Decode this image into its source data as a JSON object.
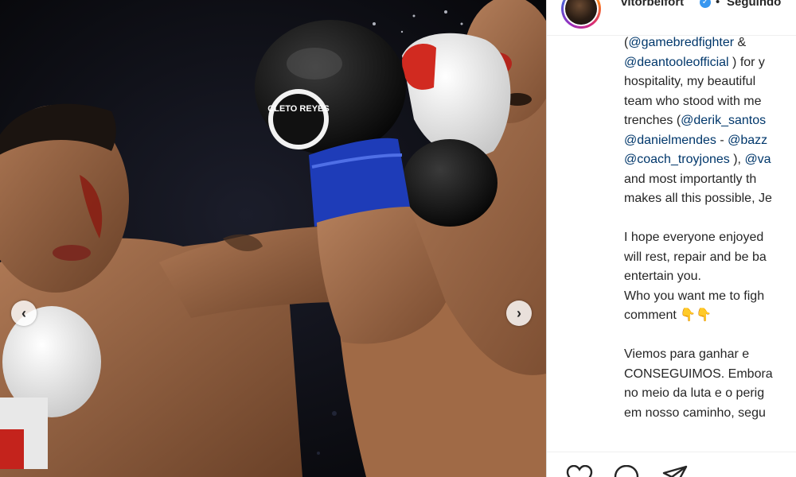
{
  "header": {
    "username": "vitorbelfort",
    "verified": "✓",
    "separator": "•",
    "follow_label": "Seguindo"
  },
  "photo": {
    "glove_brand": "CLETO REYES",
    "prev_icon": "chevron-left-icon",
    "next_icon": "chevron-right-icon",
    "prev_glyph": "‹",
    "next_glyph": "›"
  },
  "caption": {
    "lines": [
      [
        {
          "t": "(",
          "m": false
        },
        {
          "t": "@gamebredfighter",
          "m": true
        },
        {
          "t": " &",
          "m": false
        }
      ],
      [
        {
          "t": "@deantooleofficial",
          "m": true
        },
        {
          "t": " ) for y",
          "m": false
        }
      ],
      [
        {
          "t": "hospitality, my beautiful",
          "m": false
        }
      ],
      [
        {
          "t": "team who stood with me",
          "m": false
        }
      ],
      [
        {
          "t": "trenches (",
          "m": false
        },
        {
          "t": "@derik_santos",
          "m": true
        }
      ],
      [
        {
          "t": "@danielmendes",
          "m": true
        },
        {
          "t": " - ",
          "m": false
        },
        {
          "t": "@bazz",
          "m": true
        }
      ],
      [
        {
          "t": "@coach_troyjones",
          "m": true
        },
        {
          "t": " ), ",
          "m": false
        },
        {
          "t": "@va",
          "m": true
        }
      ],
      [
        {
          "t": "and most importantly th",
          "m": false
        }
      ],
      [
        {
          "t": "makes all this possible, Je",
          "m": false
        }
      ],
      [],
      [
        {
          "t": "I hope everyone enjoyed",
          "m": false
        }
      ],
      [
        {
          "t": "will rest, repair and be ba",
          "m": false
        }
      ],
      [
        {
          "t": "entertain you.",
          "m": false
        }
      ],
      [
        {
          "t": "Who you want me to figh",
          "m": false
        }
      ],
      [
        {
          "t": "comment 👇👇",
          "m": false
        }
      ],
      [],
      [
        {
          "t": "Viemos para ganhar e",
          "m": false
        }
      ],
      [
        {
          "t": "CONSEGUIMOS. Embora",
          "m": false
        }
      ],
      [
        {
          "t": "no meio da luta e o perig",
          "m": false
        }
      ],
      [
        {
          "t": "em nosso caminho, segu",
          "m": false
        }
      ]
    ]
  },
  "actions": {
    "like_icon": "heart-icon",
    "comment_icon": "comment-icon",
    "share_icon": "share-icon"
  },
  "colors": {
    "mention": "#00376b",
    "text": "#262626",
    "verified": "#3897f0",
    "divider": "#dbdbdb"
  }
}
